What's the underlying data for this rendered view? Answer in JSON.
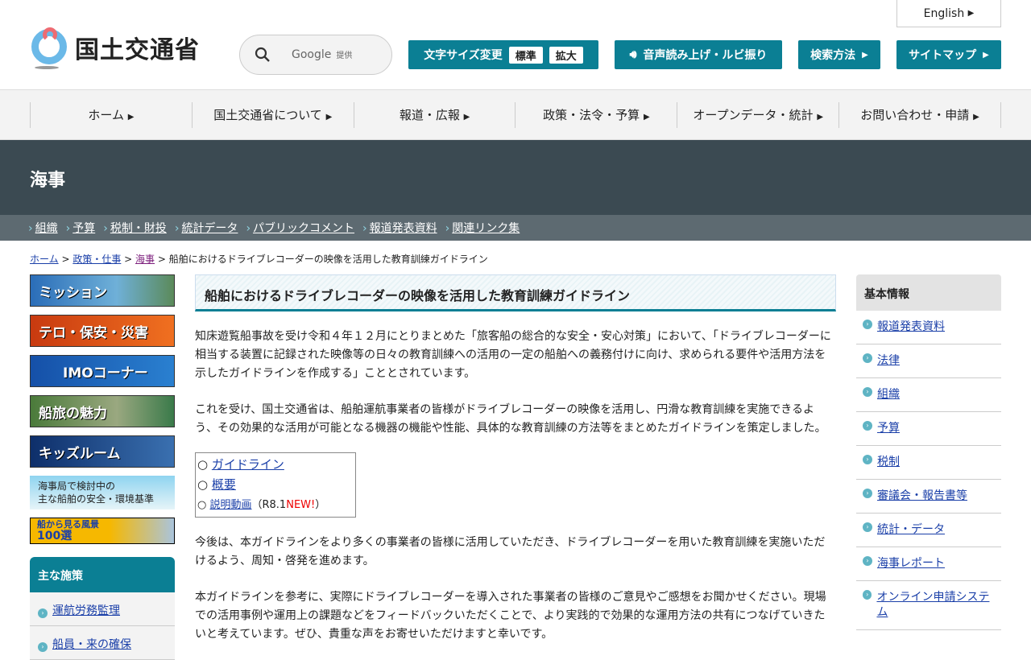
{
  "header": {
    "logo": "国土交通省",
    "search_label": "Google",
    "search_sub": "提供",
    "font_size_label": "文字サイズ変更",
    "font_std": "標準",
    "font_large": "拡大",
    "speech": "音声読み上げ・ルビ振り",
    "search_method": "検索方法",
    "sitemap": "サイトマップ",
    "english": "English"
  },
  "gnav": [
    "ホーム",
    "国土交通省について",
    "報道・広報",
    "政策・法令・予算",
    "オープンデータ・統計",
    "お問い合わせ・申請"
  ],
  "section_title": "海事",
  "subnav": [
    "組織",
    "予算",
    "税制・財投",
    "統計データ",
    "パブリックコメント",
    "報道発表資料",
    "関連リンク集"
  ],
  "breadcrumb": {
    "items": [
      "ホーム",
      "政策・仕事",
      "海事"
    ],
    "current": "船舶におけるドライブレコーダーの映像を活用した教育訓練ガイドライン"
  },
  "left_banners": [
    "ミッション",
    "テロ・保安・災害",
    "IMOコーナー",
    "船旅の魅力",
    "キッズルーム"
  ],
  "left_banner_text": {
    "line1": "海事局で検討中の",
    "line2": "主な船舶の安全・環境基準"
  },
  "scenery_banner": {
    "line1": "船から見る風景",
    "line2": "100選"
  },
  "policies": {
    "heading": "主な施策",
    "items": [
      "運航労務監理",
      "船員・来の確保"
    ]
  },
  "main": {
    "title": "船舶におけるドライブレコーダーの映像を活用した教育訓練ガイドライン",
    "p1": "知床遊覧船事故を受け令和４年１２月にとりまとめた「旅客船の総合的な安全・安心対策」において、「ドライブレコーダーに相当する装置に記録された映像等の日々の教育訓練への活用の一定の船舶への義務付けに向け、求められる要件や活用方法を示したガイドラインを作成する」こととされています。",
    "p2": "これを受け、国土交通省は、船舶運航事業者の皆様がドライブレコーダーの映像を活用し、円滑な教育訓練を実施できるよう、その効果的な活用が可能となる機器の機能や性能、具体的な教育訓練の方法等をまとめたガイドラインを策定しました。",
    "links": [
      "ガイドライン",
      "概要",
      "説明動画"
    ],
    "video_note_pre": "（R8.1",
    "video_note_new": "NEW!",
    "video_note_post": "）",
    "p3": "今後は、本ガイドラインをより多くの事業者の皆様に活用していただき、ドライブレコーダーを用いた教育訓練を実施いただけるよう、周知・啓発を進めます。",
    "p4": "本ガイドラインを参考に、実際にドライブレコーダーを導入された事業者の皆様のご意見やご感想をお聞かせください。現場での活用事例や運用上の課題などをフィードバックいただくことで、より実践的で効果的な運用方法の共有につなげていきたいと考えています。ぜひ、貴重な声をお寄せいただけますと幸いです。"
  },
  "right": {
    "heading": "基本情報",
    "items": [
      "報道発表資料",
      "法律",
      "組織",
      "予算",
      "税制",
      "審議会・報告書等",
      "統計・データ",
      "海事レポート",
      "オンライン申請システム"
    ]
  }
}
